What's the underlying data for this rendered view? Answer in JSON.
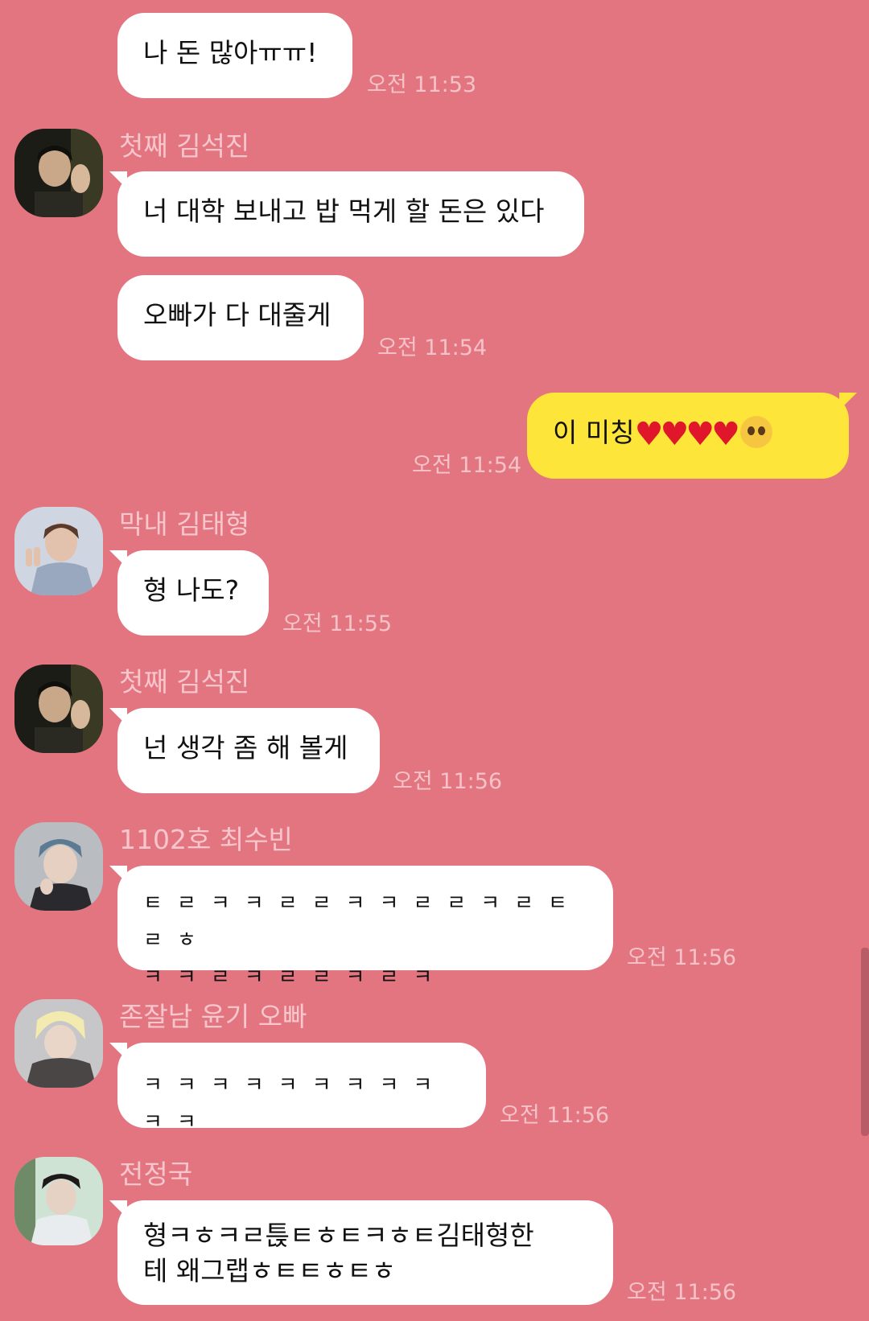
{
  "messages": [
    {
      "type": "bubble",
      "text": "나 돈 많아ㅠㅠ!",
      "time": "오전 11:53"
    },
    {
      "type": "sender",
      "name": "첫째 김석진",
      "avatar": "seokjin-avatar"
    },
    {
      "type": "bubble",
      "text": "너 대학 보내고 밥 먹게 할 돈은 있다"
    },
    {
      "type": "bubble",
      "text": "오빠가 다 대줄게",
      "time": "오전 11:54"
    },
    {
      "type": "mine",
      "text": "이 미칭",
      "emoji": "pleading-face-icon",
      "time": "오전 11:54"
    },
    {
      "type": "sender",
      "name": "막내 김태형",
      "avatar": "taehyung-avatar"
    },
    {
      "type": "bubble",
      "text": "형 나도?",
      "time": "오전 11:55"
    },
    {
      "type": "sender",
      "name": "첫째 김석진",
      "avatar": "seokjin-avatar"
    },
    {
      "type": "bubble",
      "text": "넌 생각 좀 해 볼게",
      "time": "오전 11:56"
    },
    {
      "type": "sender",
      "name": "1102호 최수빈",
      "avatar": "soobin-avatar"
    },
    {
      "type": "bubble",
      "text_line1": "ㅌㄹㅋㅋㄹㄹㅋㅋㄹㄹㅋㄹㅌㄹㅎ",
      "text_line2": "ㅋㅋㄹㅋㄹㄹㅋㄹㅋ",
      "time": "오전 11:56"
    },
    {
      "type": "sender",
      "name": "존잘남 윤기 오빠",
      "avatar": "yoongi-avatar"
    },
    {
      "type": "bubble",
      "text": "ㅋㅋㅋㅋㅋㅋㅋㅋㅋㅋㅋ",
      "time": "오전 11:56"
    },
    {
      "type": "sender",
      "name": "전정국",
      "avatar": "jungkook-avatar"
    },
    {
      "type": "bubble",
      "text_line1": "형ㅋㅎㅋㄹ튽ㅌㅎㅌㅋㅎㅌ김태형한",
      "text_line2": "테 왜그랩ㅎㅌㅌㅎㅌㅎ",
      "time": "오전 11:56"
    }
  ],
  "colors": {
    "background": "#e37581",
    "bubble": "#ffffff",
    "mine_bubble": "#fde53a",
    "time_text": "#f5c2c8",
    "name_text": "#f6c6cc"
  },
  "avatar_hearts_count": 4
}
